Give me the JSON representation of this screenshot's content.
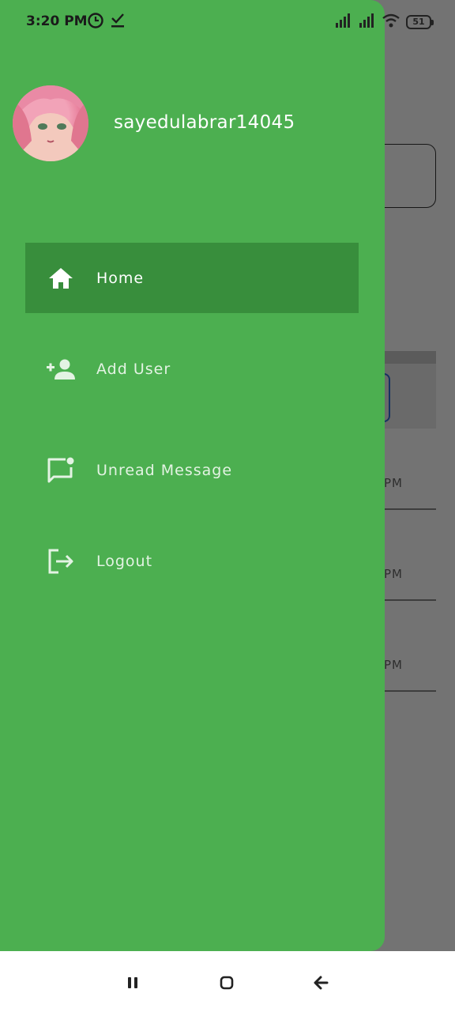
{
  "status_bar": {
    "time": "3:20 PM",
    "battery": "51",
    "icons": [
      "alarm-clock-icon",
      "download-check-icon",
      "signal-icon",
      "signal-icon",
      "wifi-icon",
      "battery-icon"
    ]
  },
  "background_app": {
    "row_times": [
      "PM",
      "PM",
      "PM"
    ]
  },
  "drawer": {
    "username": "sayedulabrar14045",
    "menu": [
      {
        "label": "Home",
        "icon": "home-icon",
        "active": true
      },
      {
        "label": "Add User",
        "icon": "add-user-icon",
        "active": false
      },
      {
        "label": "Unread Message",
        "icon": "unread-message-icon",
        "active": false
      },
      {
        "label": "Logout",
        "icon": "logout-icon",
        "active": false
      }
    ],
    "colors": {
      "background": "#4caf50",
      "active_item": "#388e3c",
      "text": "#ffffff"
    }
  },
  "nav_bar": {
    "buttons": [
      "recents-icon",
      "home-circle-icon",
      "back-arrow-icon"
    ]
  }
}
